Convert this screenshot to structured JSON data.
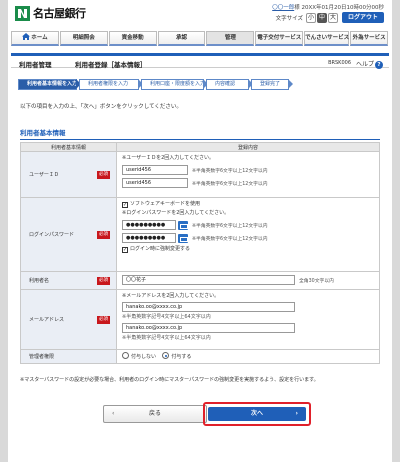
{
  "header": {
    "bank_name": "名古屋銀行",
    "user_name": "〇〇一郎",
    "user_suffix": "様",
    "last_login": "20XX年01月20日10時00分00秒",
    "font_size_label": "文字サイズ",
    "font_sizes": [
      "小",
      "中",
      "大"
    ],
    "logout_label": "ログアウト"
  },
  "nav": {
    "items": [
      {
        "label": "ホーム"
      },
      {
        "label": "明細照会"
      },
      {
        "label": "資金移動"
      },
      {
        "label": "承認"
      },
      {
        "label": "管理"
      },
      {
        "label": "電子交付サービス"
      },
      {
        "label": "でんさいサービス"
      },
      {
        "label": "外為サービス"
      }
    ]
  },
  "page": {
    "category": "利用者管理",
    "title": "利用者登録［基本情報］",
    "screen_code": "BRSK006",
    "help_label": "ヘルプ",
    "help_icon": "?"
  },
  "steps": [
    {
      "label": "利用者基本情報を入力"
    },
    {
      "label": "利用者権限を入力"
    },
    {
      "label": "利用口座・限度額を入力"
    },
    {
      "label": "内容確認"
    },
    {
      "label": "登録完了"
    }
  ],
  "instruction": "以下の項目を入力の上、「次へ」ボタンをクリックしてください。",
  "section_title": "利用者基本情報",
  "form": {
    "col_item": "利用者基本情報",
    "col_content": "登録内容",
    "required_label": "必須",
    "user_id": {
      "label": "ユーザーＩＤ",
      "instruction": "※ユーザーＩＤを2回入力してください。",
      "value1": "userid456",
      "value2": "userid456",
      "hint1": "※半角英数字6文字以上12文字以内",
      "hint2": "※半角英数字6文字以上12文字以内"
    },
    "password": {
      "label": "ログインパスワード",
      "software_keyboard_label": "ソフトウェアキーボードを使用",
      "instruction": "※ログインパスワードを2回入力してください。",
      "value1": "●●●●●●●●●",
      "value2": "●●●●●●●●●",
      "hint1": "※半角英数字6文字以上12文字以内",
      "hint2": "※半角英数字6文字以上12文字以内",
      "force_change_label": "ログイン時に強制変更する"
    },
    "user_name": {
      "label": "利用者名",
      "value": "〇〇花子",
      "hint": "全角30文字以内"
    },
    "email": {
      "label": "メールアドレス",
      "instruction": "※メールアドレスを2回入力してください。",
      "value1": "hanako.oo@xxxx.co.jp",
      "value2": "hanako.oo@xxxx.co.jp",
      "hint1": "※半角英数字記号4文字以上64文字以内",
      "hint2": "※半角英数字記号4文字以上64文字以内"
    },
    "admin_auth": {
      "label": "管理者権限",
      "option_off": "付与しない",
      "option_on": "付与する",
      "selected": "付与する"
    }
  },
  "note": "※マスターパスワードの設定が必要な場合、利用者のログイン時にマスターパスワードの強制変更を実施するよう、設定を行います。",
  "buttons": {
    "back": "戻る",
    "next": "次へ"
  },
  "colors": {
    "primary": "#1f5fb8",
    "required": "#c8171c",
    "highlight": "#e0202a"
  }
}
